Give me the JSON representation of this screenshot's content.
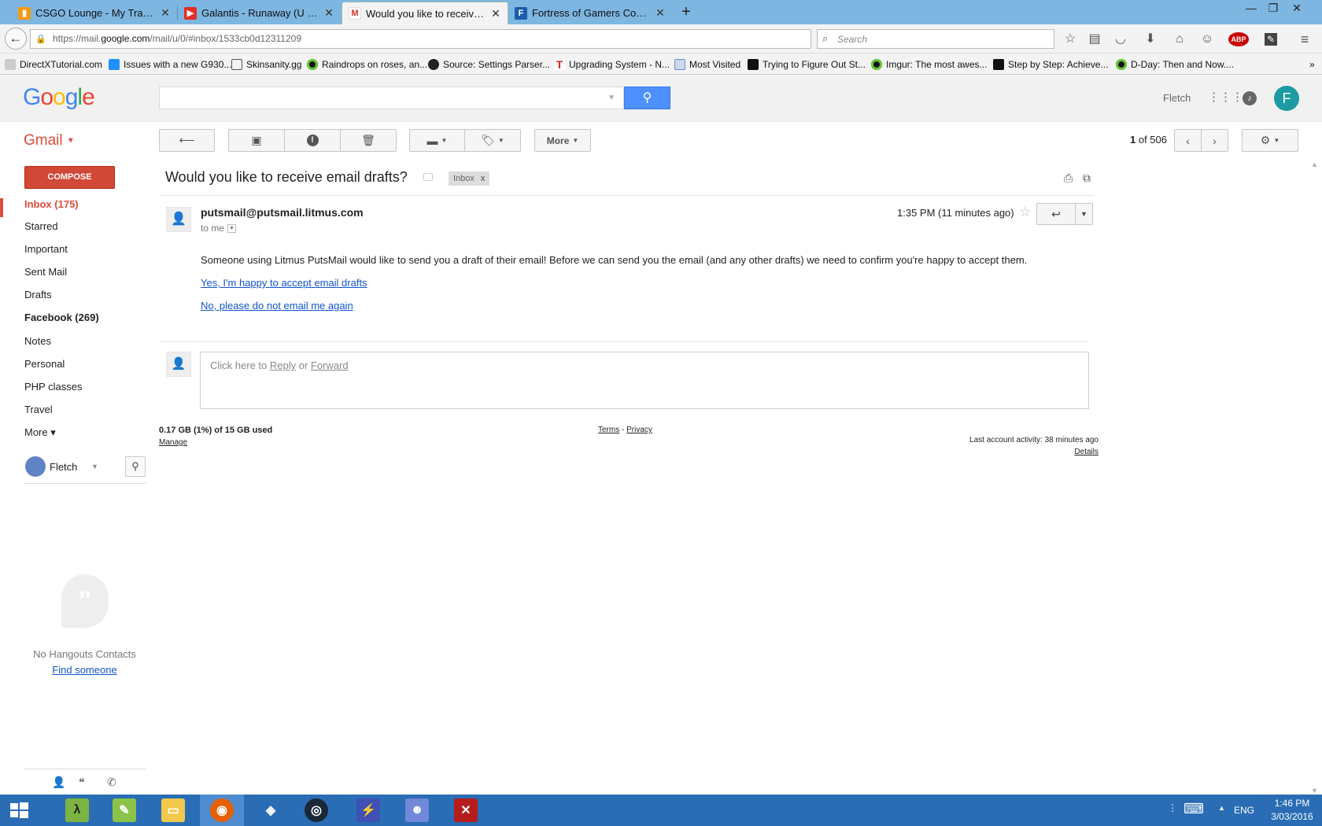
{
  "browser": {
    "tabs": [
      {
        "title": "CSGO Lounge - My Trades",
        "color": "#f29b12"
      },
      {
        "title": "Galantis - Runaway (U & I)...",
        "color": "#e52d27"
      },
      {
        "title": "Would you like to receive ...",
        "color": "#d93025",
        "active": true
      },
      {
        "title": "Fortress of Gamers Comm...",
        "color": "#1a5ea8"
      }
    ],
    "url_prefix": "https://mail.",
    "url_domain": "google.com",
    "url_path": "/mail/u/0/#inbox/1533cb0d12311209",
    "search_placeholder": "Search",
    "abp_label": "ABP",
    "bookmarks": [
      {
        "label": "DirectXTutorial.com",
        "color": "#ffffff"
      },
      {
        "label": "Issues with a new G930...",
        "color": "#1e90ff"
      },
      {
        "label": "Skinsanity.gg",
        "color": "#555555"
      },
      {
        "label": "Raindrops on roses, an...",
        "color": "#3a3"
      },
      {
        "label": "Source: Settings Parser...",
        "color": "#222222"
      },
      {
        "label": "Upgrading System - N...",
        "color": "#dd2222"
      },
      {
        "label": "Most Visited",
        "color": "#6a8fd0"
      },
      {
        "label": "Trying to Figure Out St...",
        "color": "#111111"
      },
      {
        "label": "Imgur: The most awes...",
        "color": "#3a3"
      },
      {
        "label": "Step by Step: Achieve...",
        "color": "#111111"
      },
      {
        "label": "D-Day: Then and Now....",
        "color": "#3a3"
      }
    ]
  },
  "gmail": {
    "logo": "Google",
    "app_label": "Gmail",
    "username": "Fletch",
    "avatar_letter": "F",
    "toolbar_more": "More",
    "pager_current": "1",
    "pager_text": " of 506",
    "compose": "COMPOSE",
    "nav": [
      {
        "label": "Inbox (175)",
        "style": "sel"
      },
      {
        "label": "Starred",
        "style": ""
      },
      {
        "label": "Important",
        "style": ""
      },
      {
        "label": "Sent Mail",
        "style": ""
      },
      {
        "label": "Drafts",
        "style": ""
      },
      {
        "label": "Facebook (269)",
        "style": "bold"
      },
      {
        "label": "Notes",
        "style": ""
      },
      {
        "label": "Personal",
        "style": ""
      },
      {
        "label": "PHP classes",
        "style": ""
      },
      {
        "label": "Travel",
        "style": ""
      },
      {
        "label": "More ▾",
        "style": ""
      }
    ],
    "hangouts_user": "Fletch",
    "no_hangouts": "No Hangouts Contacts",
    "find_someone": "Find someone"
  },
  "message": {
    "subject": "Would you like to receive email drafts?",
    "label": "Inbox",
    "label_close": "x",
    "sender": "putsmail@putsmail.litmus.com",
    "to": "to me",
    "time": "1:35 PM (11 minutes ago)",
    "body": "Someone using Litmus PutsMail would like to send you a draft of their email! Before we can send you the email (and any other drafts) we need to confirm you're happy to accept them.",
    "link_accept": "Yes, I'm happy to accept email drafts",
    "link_decline": "No, please do not email me again",
    "reply_prefix": "Click here to ",
    "reply_word": "Reply",
    "reply_or": " or ",
    "forward_word": "Forward"
  },
  "footer": {
    "storage": "0.17 GB (1%) of 15 GB used",
    "manage": "Manage",
    "terms": "Terms",
    "sep": " - ",
    "privacy": "Privacy",
    "last_activity": "Last account activity: 38 minutes ago",
    "details": "Details"
  },
  "taskbar": {
    "language": "ENG",
    "time": "1:46 PM",
    "date": "3/03/2016"
  }
}
